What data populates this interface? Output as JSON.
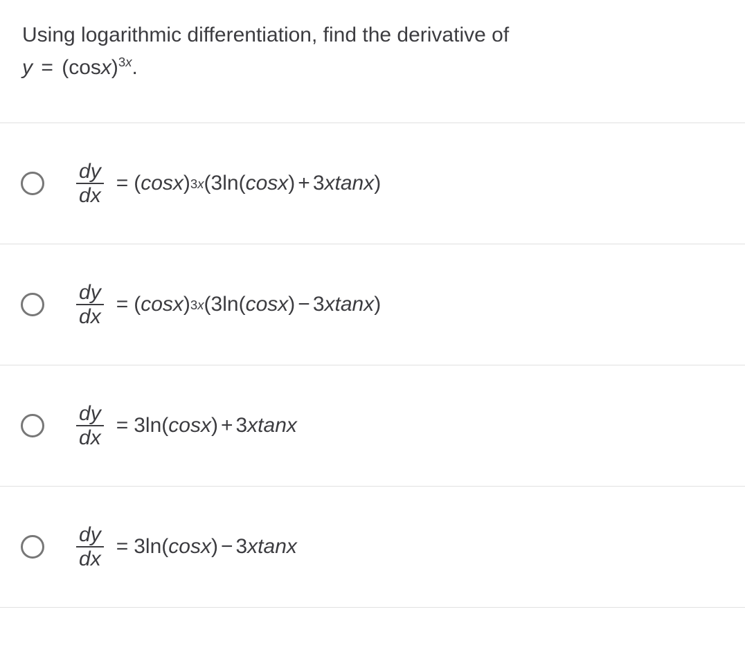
{
  "question": {
    "line1": "Using logarithmic differentiation, find the derivative of",
    "y": "y",
    "eq": "=",
    "cos": "cos",
    "x": "x",
    "exp3": "3",
    "expx": "x",
    "period": "."
  },
  "frac": {
    "num_d": "d",
    "num_y": "y",
    "den_d": "d",
    "den_x": "x"
  },
  "sym": {
    "eq": "=",
    "lp": "(",
    "rp": ")",
    "plus": "+",
    "minus": "−",
    "three": "3",
    "ln": "ln",
    "cos": "cos",
    "tan": "tan",
    "x": "x"
  },
  "options": {
    "a": {
      "sign": "+",
      "hasCoef": true
    },
    "b": {
      "sign": "−",
      "hasCoef": true
    },
    "c": {
      "sign": "+",
      "hasCoef": false
    },
    "d": {
      "sign": "−",
      "hasCoef": false
    }
  }
}
